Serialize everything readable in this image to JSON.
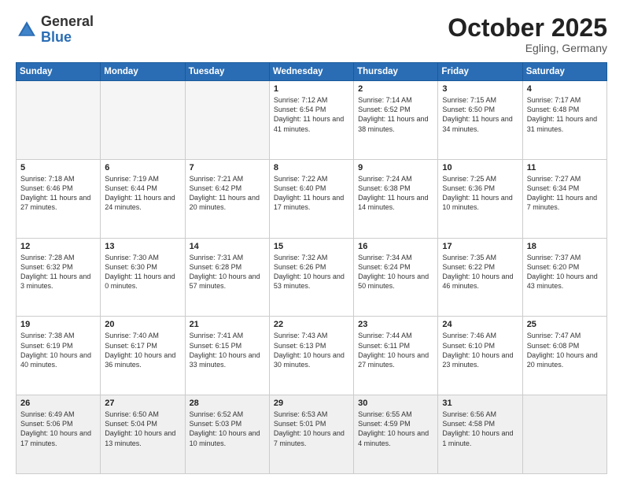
{
  "header": {
    "logo_general": "General",
    "logo_blue": "Blue",
    "month": "October 2025",
    "location": "Egling, Germany"
  },
  "weekdays": [
    "Sunday",
    "Monday",
    "Tuesday",
    "Wednesday",
    "Thursday",
    "Friday",
    "Saturday"
  ],
  "weeks": [
    [
      {
        "day": "",
        "info": ""
      },
      {
        "day": "",
        "info": ""
      },
      {
        "day": "",
        "info": ""
      },
      {
        "day": "1",
        "info": "Sunrise: 7:12 AM\nSunset: 6:54 PM\nDaylight: 11 hours\nand 41 minutes."
      },
      {
        "day": "2",
        "info": "Sunrise: 7:14 AM\nSunset: 6:52 PM\nDaylight: 11 hours\nand 38 minutes."
      },
      {
        "day": "3",
        "info": "Sunrise: 7:15 AM\nSunset: 6:50 PM\nDaylight: 11 hours\nand 34 minutes."
      },
      {
        "day": "4",
        "info": "Sunrise: 7:17 AM\nSunset: 6:48 PM\nDaylight: 11 hours\nand 31 minutes."
      }
    ],
    [
      {
        "day": "5",
        "info": "Sunrise: 7:18 AM\nSunset: 6:46 PM\nDaylight: 11 hours\nand 27 minutes."
      },
      {
        "day": "6",
        "info": "Sunrise: 7:19 AM\nSunset: 6:44 PM\nDaylight: 11 hours\nand 24 minutes."
      },
      {
        "day": "7",
        "info": "Sunrise: 7:21 AM\nSunset: 6:42 PM\nDaylight: 11 hours\nand 20 minutes."
      },
      {
        "day": "8",
        "info": "Sunrise: 7:22 AM\nSunset: 6:40 PM\nDaylight: 11 hours\nand 17 minutes."
      },
      {
        "day": "9",
        "info": "Sunrise: 7:24 AM\nSunset: 6:38 PM\nDaylight: 11 hours\nand 14 minutes."
      },
      {
        "day": "10",
        "info": "Sunrise: 7:25 AM\nSunset: 6:36 PM\nDaylight: 11 hours\nand 10 minutes."
      },
      {
        "day": "11",
        "info": "Sunrise: 7:27 AM\nSunset: 6:34 PM\nDaylight: 11 hours\nand 7 minutes."
      }
    ],
    [
      {
        "day": "12",
        "info": "Sunrise: 7:28 AM\nSunset: 6:32 PM\nDaylight: 11 hours\nand 3 minutes."
      },
      {
        "day": "13",
        "info": "Sunrise: 7:30 AM\nSunset: 6:30 PM\nDaylight: 11 hours\nand 0 minutes."
      },
      {
        "day": "14",
        "info": "Sunrise: 7:31 AM\nSunset: 6:28 PM\nDaylight: 10 hours\nand 57 minutes."
      },
      {
        "day": "15",
        "info": "Sunrise: 7:32 AM\nSunset: 6:26 PM\nDaylight: 10 hours\nand 53 minutes."
      },
      {
        "day": "16",
        "info": "Sunrise: 7:34 AM\nSunset: 6:24 PM\nDaylight: 10 hours\nand 50 minutes."
      },
      {
        "day": "17",
        "info": "Sunrise: 7:35 AM\nSunset: 6:22 PM\nDaylight: 10 hours\nand 46 minutes."
      },
      {
        "day": "18",
        "info": "Sunrise: 7:37 AM\nSunset: 6:20 PM\nDaylight: 10 hours\nand 43 minutes."
      }
    ],
    [
      {
        "day": "19",
        "info": "Sunrise: 7:38 AM\nSunset: 6:19 PM\nDaylight: 10 hours\nand 40 minutes."
      },
      {
        "day": "20",
        "info": "Sunrise: 7:40 AM\nSunset: 6:17 PM\nDaylight: 10 hours\nand 36 minutes."
      },
      {
        "day": "21",
        "info": "Sunrise: 7:41 AM\nSunset: 6:15 PM\nDaylight: 10 hours\nand 33 minutes."
      },
      {
        "day": "22",
        "info": "Sunrise: 7:43 AM\nSunset: 6:13 PM\nDaylight: 10 hours\nand 30 minutes."
      },
      {
        "day": "23",
        "info": "Sunrise: 7:44 AM\nSunset: 6:11 PM\nDaylight: 10 hours\nand 27 minutes."
      },
      {
        "day": "24",
        "info": "Sunrise: 7:46 AM\nSunset: 6:10 PM\nDaylight: 10 hours\nand 23 minutes."
      },
      {
        "day": "25",
        "info": "Sunrise: 7:47 AM\nSunset: 6:08 PM\nDaylight: 10 hours\nand 20 minutes."
      }
    ],
    [
      {
        "day": "26",
        "info": "Sunrise: 6:49 AM\nSunset: 5:06 PM\nDaylight: 10 hours\nand 17 minutes."
      },
      {
        "day": "27",
        "info": "Sunrise: 6:50 AM\nSunset: 5:04 PM\nDaylight: 10 hours\nand 13 minutes."
      },
      {
        "day": "28",
        "info": "Sunrise: 6:52 AM\nSunset: 5:03 PM\nDaylight: 10 hours\nand 10 minutes."
      },
      {
        "day": "29",
        "info": "Sunrise: 6:53 AM\nSunset: 5:01 PM\nDaylight: 10 hours\nand 7 minutes."
      },
      {
        "day": "30",
        "info": "Sunrise: 6:55 AM\nSunset: 4:59 PM\nDaylight: 10 hours\nand 4 minutes."
      },
      {
        "day": "31",
        "info": "Sunrise: 6:56 AM\nSunset: 4:58 PM\nDaylight: 10 hours\nand 1 minute."
      },
      {
        "day": "",
        "info": ""
      }
    ]
  ]
}
